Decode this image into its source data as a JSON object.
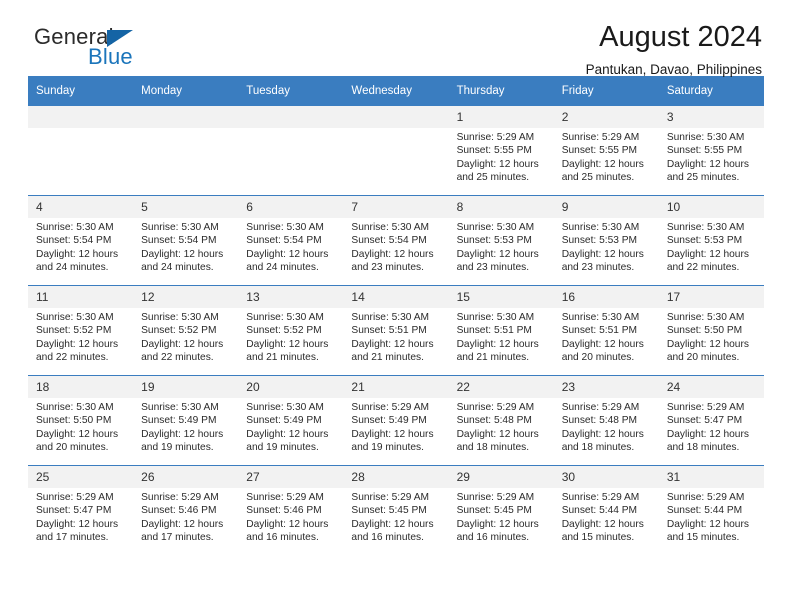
{
  "brand": {
    "name_part1": "General",
    "name_part2": "Blue",
    "triangle_color": "#1464a5",
    "blue_color": "#1b75bb"
  },
  "header": {
    "title": "August 2024",
    "subtitle": "Pantukan, Davao, Philippines"
  },
  "theme": {
    "header_row_bg": "#3a7dc0",
    "daynum_bg": "#f2f2f2",
    "text": "#2b2b2b"
  },
  "calendar": {
    "weekday_headers": [
      "Sunday",
      "Monday",
      "Tuesday",
      "Wednesday",
      "Thursday",
      "Friday",
      "Saturday"
    ],
    "labels": {
      "sunrise": "Sunrise:",
      "sunset": "Sunset:",
      "daylight": "Daylight:"
    },
    "weeks": [
      [
        {
          "day": "",
          "empty": true
        },
        {
          "day": "",
          "empty": true
        },
        {
          "day": "",
          "empty": true
        },
        {
          "day": "",
          "empty": true
        },
        {
          "day": "1",
          "sunrise": "Sunrise: 5:29 AM",
          "sunset": "Sunset: 5:55 PM",
          "daylight_line1": "Daylight: 12 hours",
          "daylight_line2": "and 25 minutes."
        },
        {
          "day": "2",
          "sunrise": "Sunrise: 5:29 AM",
          "sunset": "Sunset: 5:55 PM",
          "daylight_line1": "Daylight: 12 hours",
          "daylight_line2": "and 25 minutes."
        },
        {
          "day": "3",
          "sunrise": "Sunrise: 5:30 AM",
          "sunset": "Sunset: 5:55 PM",
          "daylight_line1": "Daylight: 12 hours",
          "daylight_line2": "and 25 minutes."
        }
      ],
      [
        {
          "day": "4",
          "sunrise": "Sunrise: 5:30 AM",
          "sunset": "Sunset: 5:54 PM",
          "daylight_line1": "Daylight: 12 hours",
          "daylight_line2": "and 24 minutes."
        },
        {
          "day": "5",
          "sunrise": "Sunrise: 5:30 AM",
          "sunset": "Sunset: 5:54 PM",
          "daylight_line1": "Daylight: 12 hours",
          "daylight_line2": "and 24 minutes."
        },
        {
          "day": "6",
          "sunrise": "Sunrise: 5:30 AM",
          "sunset": "Sunset: 5:54 PM",
          "daylight_line1": "Daylight: 12 hours",
          "daylight_line2": "and 24 minutes."
        },
        {
          "day": "7",
          "sunrise": "Sunrise: 5:30 AM",
          "sunset": "Sunset: 5:54 PM",
          "daylight_line1": "Daylight: 12 hours",
          "daylight_line2": "and 23 minutes."
        },
        {
          "day": "8",
          "sunrise": "Sunrise: 5:30 AM",
          "sunset": "Sunset: 5:53 PM",
          "daylight_line1": "Daylight: 12 hours",
          "daylight_line2": "and 23 minutes."
        },
        {
          "day": "9",
          "sunrise": "Sunrise: 5:30 AM",
          "sunset": "Sunset: 5:53 PM",
          "daylight_line1": "Daylight: 12 hours",
          "daylight_line2": "and 23 minutes."
        },
        {
          "day": "10",
          "sunrise": "Sunrise: 5:30 AM",
          "sunset": "Sunset: 5:53 PM",
          "daylight_line1": "Daylight: 12 hours",
          "daylight_line2": "and 22 minutes."
        }
      ],
      [
        {
          "day": "11",
          "sunrise": "Sunrise: 5:30 AM",
          "sunset": "Sunset: 5:52 PM",
          "daylight_line1": "Daylight: 12 hours",
          "daylight_line2": "and 22 minutes."
        },
        {
          "day": "12",
          "sunrise": "Sunrise: 5:30 AM",
          "sunset": "Sunset: 5:52 PM",
          "daylight_line1": "Daylight: 12 hours",
          "daylight_line2": "and 22 minutes."
        },
        {
          "day": "13",
          "sunrise": "Sunrise: 5:30 AM",
          "sunset": "Sunset: 5:52 PM",
          "daylight_line1": "Daylight: 12 hours",
          "daylight_line2": "and 21 minutes."
        },
        {
          "day": "14",
          "sunrise": "Sunrise: 5:30 AM",
          "sunset": "Sunset: 5:51 PM",
          "daylight_line1": "Daylight: 12 hours",
          "daylight_line2": "and 21 minutes."
        },
        {
          "day": "15",
          "sunrise": "Sunrise: 5:30 AM",
          "sunset": "Sunset: 5:51 PM",
          "daylight_line1": "Daylight: 12 hours",
          "daylight_line2": "and 21 minutes."
        },
        {
          "day": "16",
          "sunrise": "Sunrise: 5:30 AM",
          "sunset": "Sunset: 5:51 PM",
          "daylight_line1": "Daylight: 12 hours",
          "daylight_line2": "and 20 minutes."
        },
        {
          "day": "17",
          "sunrise": "Sunrise: 5:30 AM",
          "sunset": "Sunset: 5:50 PM",
          "daylight_line1": "Daylight: 12 hours",
          "daylight_line2": "and 20 minutes."
        }
      ],
      [
        {
          "day": "18",
          "sunrise": "Sunrise: 5:30 AM",
          "sunset": "Sunset: 5:50 PM",
          "daylight_line1": "Daylight: 12 hours",
          "daylight_line2": "and 20 minutes."
        },
        {
          "day": "19",
          "sunrise": "Sunrise: 5:30 AM",
          "sunset": "Sunset: 5:49 PM",
          "daylight_line1": "Daylight: 12 hours",
          "daylight_line2": "and 19 minutes."
        },
        {
          "day": "20",
          "sunrise": "Sunrise: 5:30 AM",
          "sunset": "Sunset: 5:49 PM",
          "daylight_line1": "Daylight: 12 hours",
          "daylight_line2": "and 19 minutes."
        },
        {
          "day": "21",
          "sunrise": "Sunrise: 5:29 AM",
          "sunset": "Sunset: 5:49 PM",
          "daylight_line1": "Daylight: 12 hours",
          "daylight_line2": "and 19 minutes."
        },
        {
          "day": "22",
          "sunrise": "Sunrise: 5:29 AM",
          "sunset": "Sunset: 5:48 PM",
          "daylight_line1": "Daylight: 12 hours",
          "daylight_line2": "and 18 minutes."
        },
        {
          "day": "23",
          "sunrise": "Sunrise: 5:29 AM",
          "sunset": "Sunset: 5:48 PM",
          "daylight_line1": "Daylight: 12 hours",
          "daylight_line2": "and 18 minutes."
        },
        {
          "day": "24",
          "sunrise": "Sunrise: 5:29 AM",
          "sunset": "Sunset: 5:47 PM",
          "daylight_line1": "Daylight: 12 hours",
          "daylight_line2": "and 18 minutes."
        }
      ],
      [
        {
          "day": "25",
          "sunrise": "Sunrise: 5:29 AM",
          "sunset": "Sunset: 5:47 PM",
          "daylight_line1": "Daylight: 12 hours",
          "daylight_line2": "and 17 minutes."
        },
        {
          "day": "26",
          "sunrise": "Sunrise: 5:29 AM",
          "sunset": "Sunset: 5:46 PM",
          "daylight_line1": "Daylight: 12 hours",
          "daylight_line2": "and 17 minutes."
        },
        {
          "day": "27",
          "sunrise": "Sunrise: 5:29 AM",
          "sunset": "Sunset: 5:46 PM",
          "daylight_line1": "Daylight: 12 hours",
          "daylight_line2": "and 16 minutes."
        },
        {
          "day": "28",
          "sunrise": "Sunrise: 5:29 AM",
          "sunset": "Sunset: 5:45 PM",
          "daylight_line1": "Daylight: 12 hours",
          "daylight_line2": "and 16 minutes."
        },
        {
          "day": "29",
          "sunrise": "Sunrise: 5:29 AM",
          "sunset": "Sunset: 5:45 PM",
          "daylight_line1": "Daylight: 12 hours",
          "daylight_line2": "and 16 minutes."
        },
        {
          "day": "30",
          "sunrise": "Sunrise: 5:29 AM",
          "sunset": "Sunset: 5:44 PM",
          "daylight_line1": "Daylight: 12 hours",
          "daylight_line2": "and 15 minutes."
        },
        {
          "day": "31",
          "sunrise": "Sunrise: 5:29 AM",
          "sunset": "Sunset: 5:44 PM",
          "daylight_line1": "Daylight: 12 hours",
          "daylight_line2": "and 15 minutes."
        }
      ]
    ]
  }
}
